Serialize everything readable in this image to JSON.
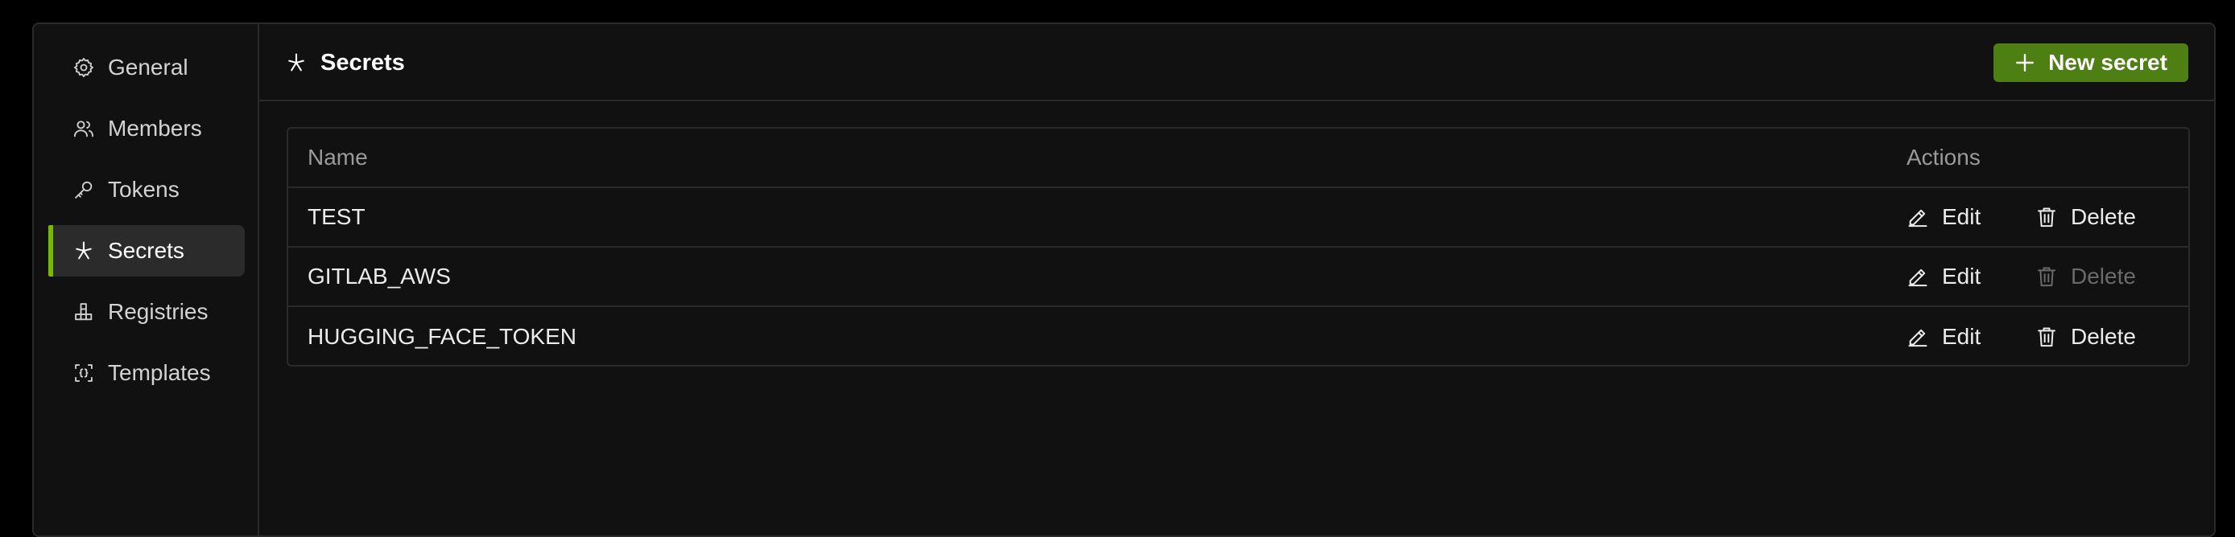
{
  "sidebar": {
    "items": [
      {
        "label": "General",
        "icon": "gear-icon"
      },
      {
        "label": "Members",
        "icon": "users-icon"
      },
      {
        "label": "Tokens",
        "icon": "key-icon"
      },
      {
        "label": "Secrets",
        "icon": "asterisk-icon",
        "active": true
      },
      {
        "label": "Registries",
        "icon": "registry-icon"
      },
      {
        "label": "Templates",
        "icon": "template-icon"
      }
    ]
  },
  "header": {
    "title": "Secrets",
    "title_icon": "asterisk-icon",
    "new_button_label": "New secret"
  },
  "table": {
    "columns": [
      "Name",
      "Actions"
    ],
    "rows": [
      {
        "name": "TEST",
        "edit_label": "Edit",
        "delete_label": "Delete",
        "delete_enabled": true
      },
      {
        "name": "GITLAB_AWS",
        "edit_label": "Edit",
        "delete_label": "Delete",
        "delete_enabled": false
      },
      {
        "name": "HUGGING_FACE_TOKEN",
        "edit_label": "Edit",
        "delete_label": "Delete",
        "delete_enabled": true
      }
    ]
  },
  "colors": {
    "accent": "#76b900",
    "button_bg": "#4e7f12",
    "background": "#111111",
    "border": "#2a2a2a"
  }
}
